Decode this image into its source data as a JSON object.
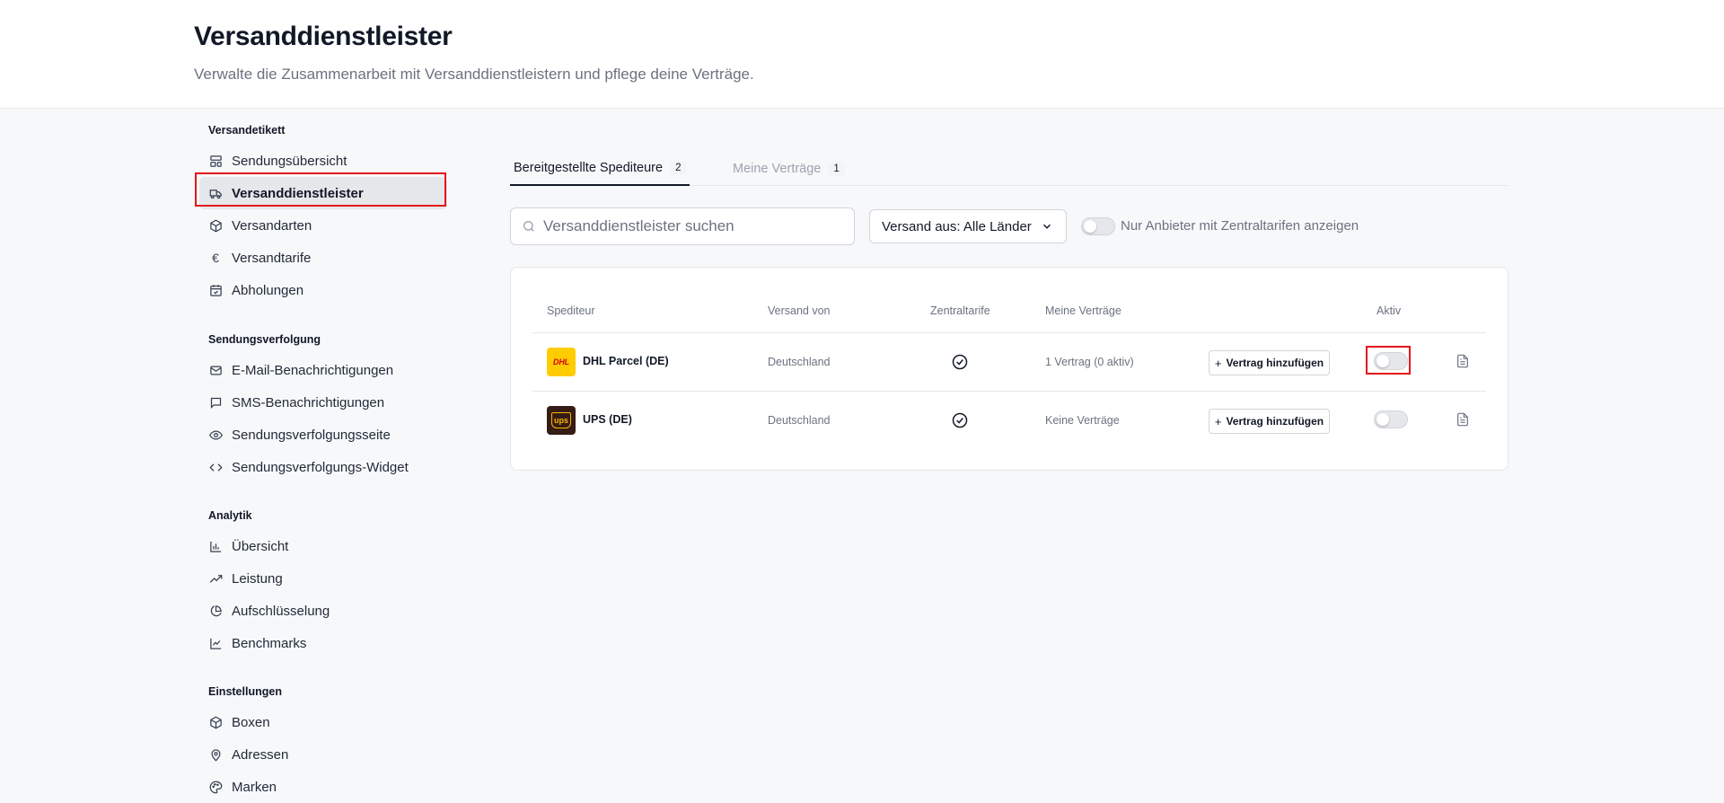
{
  "header": {
    "title": "Versanddienstleister",
    "subtitle": "Verwalte die Zusammenarbeit mit Versanddienstleistern und pflege deine Verträge."
  },
  "sidebar": {
    "sections": [
      {
        "title": "Versandetikett",
        "items": [
          {
            "label": "Sendungsübersicht",
            "icon": "layout-icon"
          },
          {
            "label": "Versanddienstleister",
            "icon": "truck-icon",
            "active": true
          },
          {
            "label": "Versandarten",
            "icon": "package-icon"
          },
          {
            "label": "Versandtarife",
            "icon": "euro-icon"
          },
          {
            "label": "Abholungen",
            "icon": "calendar-icon"
          }
        ]
      },
      {
        "title": "Sendungsverfolgung",
        "items": [
          {
            "label": "E-Mail-Benachrichtigungen",
            "icon": "mail-icon"
          },
          {
            "label": "SMS-Benachrichtigungen",
            "icon": "message-icon"
          },
          {
            "label": "Sendungsverfolgungsseite",
            "icon": "eye-icon"
          },
          {
            "label": "Sendungsverfolgungs-Widget",
            "icon": "code-icon"
          }
        ]
      },
      {
        "title": "Analytik",
        "items": [
          {
            "label": "Übersicht",
            "icon": "bar-chart-icon"
          },
          {
            "label": "Leistung",
            "icon": "trending-up-icon"
          },
          {
            "label": "Aufschlüsselung",
            "icon": "pie-chart-icon"
          },
          {
            "label": "Benchmarks",
            "icon": "line-chart-icon"
          }
        ]
      },
      {
        "title": "Einstellungen",
        "items": [
          {
            "label": "Boxen",
            "icon": "box-icon"
          },
          {
            "label": "Adressen",
            "icon": "map-pin-icon"
          },
          {
            "label": "Marken",
            "icon": "palette-icon"
          }
        ]
      }
    ]
  },
  "tabs": [
    {
      "label": "Bereitgestellte Spediteure",
      "count": "2",
      "active": true
    },
    {
      "label": "Meine Verträge",
      "count": "1",
      "active": false
    }
  ],
  "filters": {
    "search_placeholder": "Versanddienstleister suchen",
    "country_select": "Versand aus: Alle Länder",
    "central_rates_toggle_label": "Nur Anbieter mit Zentraltarifen anzeigen",
    "central_rates_toggle_on": false
  },
  "table": {
    "headers": {
      "carrier": "Spediteur",
      "ship_from": "Versand von",
      "central_rates": "Zentraltarife",
      "contracts": "Meine Verträge",
      "active": "Aktiv"
    },
    "rows": [
      {
        "carrier": "DHL Parcel (DE)",
        "logo_text": "DHL",
        "ship_from": "Deutschland",
        "central_rates": true,
        "contracts": "1 Vertrag (0 aktiv)",
        "add_label": "Vertrag hinzufügen",
        "active": false
      },
      {
        "carrier": "UPS (DE)",
        "logo_text": "ups",
        "ship_from": "Deutschland",
        "central_rates": true,
        "contracts": "Keine Verträge",
        "add_label": "Vertrag hinzufügen",
        "active": false
      }
    ]
  },
  "colors": {
    "highlight": "#e3151d",
    "dhl_yellow": "#ffcc00",
    "dhl_red": "#d40511",
    "ups_brown": "#351c15",
    "ups_gold": "#ffb500"
  }
}
